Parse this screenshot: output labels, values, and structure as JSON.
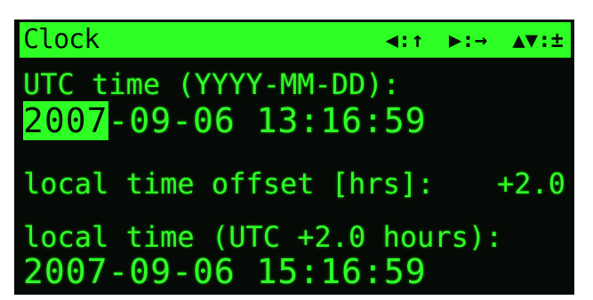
{
  "header": {
    "title": "Clock",
    "hint_left": "◀:↑",
    "hint_right": "▶:→",
    "hint_updown": "▲▼:±"
  },
  "utc": {
    "label": "UTC time (YYYY-MM-DD):",
    "year_selected": "2007",
    "rest": "-09-06 13:16:59"
  },
  "offset": {
    "label": "local time offset [hrs]:",
    "value": "+2.0"
  },
  "local": {
    "label": "local time (UTC +2.0 hours):",
    "value": "2007-09-06 15:16:59"
  },
  "colors": {
    "phosphor": "#2dff24",
    "background": "#060a06"
  }
}
